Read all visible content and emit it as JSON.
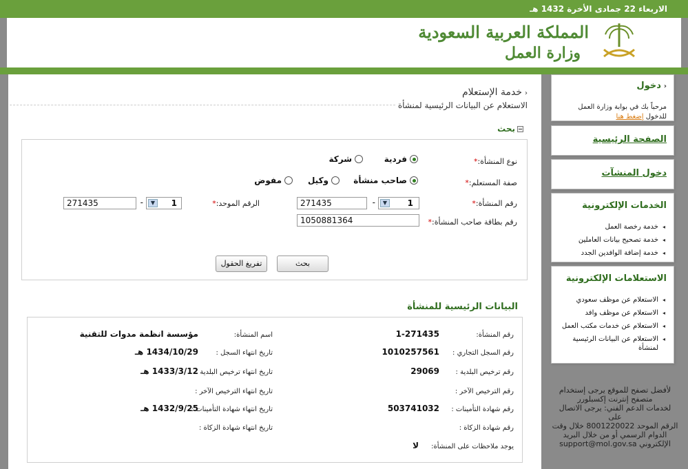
{
  "date_bar": "الاربعاء 22 جمادى الأخرة 1432 هـ",
  "logo": {
    "line1": "المملكة العربية السعودية",
    "line2": "وزارة العمل"
  },
  "sidebar": {
    "login": {
      "title": "دخول",
      "welcome": "مرحباً بك في بوابة وزارة العمل",
      "prompt": "للدخول",
      "link": "إضغط هنا"
    },
    "home": {
      "title": "الصفحة الرئيسية"
    },
    "establishments": {
      "title": "دخول المنشآت"
    },
    "eservices": {
      "title": "الخدمات الإلكترونية",
      "items": [
        "خدمة رخصة العمل",
        "خدمة تصحيح بيانات العاملين",
        "خدمة إضافة الوافدين الجدد"
      ]
    },
    "einquiries": {
      "title": "الاستعلامات الإلكترونية",
      "items": [
        "الاستعلام عن موظف سعودي",
        "الاستعلام عن موظف وافد",
        "الاستعلام عن خدمات مكتب العمل",
        "الاستعلام عن البيانات الرئيسية لمنشأة"
      ]
    },
    "footer": [
      "لأفضل تصفح للموقع يرجى إستخدام",
      "متصفح إنترنت إكسبلورر",
      "لخدمات الدعم الفني: يرجى الاتصال على",
      "الرقم الموحد 8001220022 خلال وقت",
      "الدوام الرسمي أو من خلال البريد",
      "الإلكتروني support@mol.gov.sa"
    ]
  },
  "main": {
    "title": "خدمة الإستعلام",
    "subtitle": "الاستعلام عن البيانات الرئيسية لمنشأة",
    "search_header": "بحث",
    "form": {
      "type_label": "نوع المنشأة:",
      "type_options": [
        "فردية",
        "شركة"
      ],
      "type_selected": "فردية",
      "capacity_label": "صفة المستعلم:",
      "capacity_options": [
        "صاحب منشأة",
        "وكيل",
        "مفوض"
      ],
      "est_number_label": "رقم المنشأة:",
      "est_office": "1",
      "est_number": "271435",
      "unified_label": "الرقم الموحد:",
      "unified_office": "1",
      "unified_number": "271435",
      "owner_id_label": "رقم بطاقة صاحب المنشأة:",
      "owner_id": "1050881364",
      "search_button": "بحث",
      "clear_button": "تفريغ الحقول",
      "required_mark": "*",
      "dash": "-"
    },
    "results_header": "البيانات الرئيسية للمنشأة",
    "results": {
      "est_number_label": "رقم المنشأة:",
      "est_number": "1-271435",
      "est_name_label": "اسم المنشأة:",
      "est_name": "مؤسسة انظمة مدوات للتقنية",
      "cr_label": "رقم السجل التجاري :",
      "cr": "1010257561",
      "cr_exp_label": "تاريخ انتهاء السجل :",
      "cr_exp": "1434/10/29 هـ",
      "muni_label": "رقم ترخيص البلدية :",
      "muni": "29069",
      "muni_exp_label": "تاريخ انتهاء ترخيص البلدية :",
      "muni_exp": "1433/3/12 هـ",
      "other_lic_label": "رقم الترخيص الآخر :",
      "other_lic_exp_label": "تاريخ انتهاء الترخيص الآخر :",
      "ins_label": "رقم شهادة التأمينات :",
      "ins": "503741032",
      "ins_exp_label": "تاريخ انتهاء شهادة التأمينات :",
      "ins_exp": "1432/9/25 هـ",
      "zakat_label": "رقم شهادة الزكاة :",
      "zakat_exp_label": "تاريخ انتهاء شهادة الزكاة :",
      "notes_label": "يوجد ملاحظات على المنشأة:",
      "notes": "لا"
    }
  }
}
